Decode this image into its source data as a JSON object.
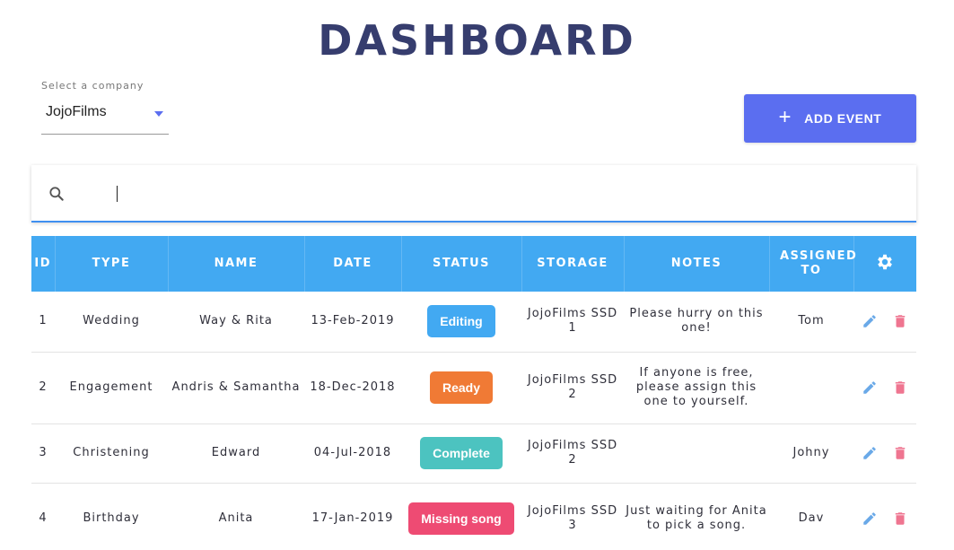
{
  "page": {
    "title": "DASHBOARD"
  },
  "company_select": {
    "label": "Select a company",
    "value": "JojoFilms"
  },
  "add_event": {
    "label": "ADD EVENT",
    "icon": "plus-icon"
  },
  "search": {
    "value": "",
    "icon": "search-icon"
  },
  "table": {
    "headers": [
      "ID",
      "TYPE",
      "NAME",
      "DATE",
      "STATUS",
      "STORAGE",
      "NOTES",
      "ASSIGNED TO"
    ],
    "settings_icon": "gear-icon",
    "rows": [
      {
        "id": "1",
        "type": "Wedding",
        "name": "Way & Rita",
        "date": "13-Feb-2019",
        "status": "Editing",
        "status_color": "#42a9f2",
        "storage": "JojoFilms SSD 1",
        "notes": "Please hurry on this one!",
        "assigned": "Tom"
      },
      {
        "id": "2",
        "type": "Engagement",
        "name": "Andris & Samantha",
        "date": "18-Dec-2018",
        "status": "Ready",
        "status_color": "#f07a35",
        "storage": "JojoFilms SSD 2",
        "notes": "If anyone is free, please assign this one to yourself.",
        "assigned": ""
      },
      {
        "id": "3",
        "type": "Christening",
        "name": "Edward",
        "date": "04-Jul-2018",
        "status": "Complete",
        "status_color": "#4cc3c0",
        "storage": "JojoFilms SSD 2",
        "notes": "",
        "assigned": "Johny"
      },
      {
        "id": "4",
        "type": "Birthday",
        "name": "Anita",
        "date": "17-Jan-2019",
        "status": "Missing song",
        "status_color": "#ee4b73",
        "storage": "JojoFilms SSD 3",
        "notes": "Just waiting for Anita to pick a song.",
        "assigned": "Dav"
      }
    ],
    "row_actions": {
      "edit_icon": "pencil-icon",
      "delete_icon": "trash-icon",
      "edit_color": "#6aa9e8",
      "delete_color": "#ef7590"
    }
  },
  "colors": {
    "accent": "#5b6ef0",
    "header": "#42a9f2",
    "title": "#363d6e"
  }
}
